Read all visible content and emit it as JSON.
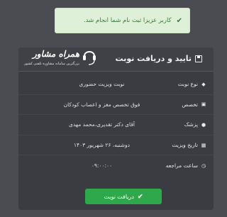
{
  "alert": {
    "message": "کاربر عزیزا ثبت نام شما انجام شد.",
    "icon": "check-icon"
  },
  "card": {
    "title": "تایید و دریافت نوبت",
    "title_icon": "save-icon"
  },
  "logo": {
    "name": "همراه مشاور",
    "tagline": "بزرگترین سامانه مشاوره تلفنی کشور",
    "icon": "headset-icon"
  },
  "rows": [
    {
      "icon": "tag-icon",
      "label": "نوع نوبت",
      "value": "نوبت ویزیت حضوری"
    },
    {
      "icon": "medkit-icon",
      "label": "تخصص",
      "value": "فوق تخصص مغز و اعصاب کودکان"
    },
    {
      "icon": "doctor-icon",
      "label": "پزشک",
      "value": "آقای دکتر تقدیری،محمد مهدی"
    },
    {
      "icon": "calendar-icon",
      "label": "تاریخ ویزیت",
      "value": "دوشنبه، ۲۶ شهریور ۱۴۰۳"
    },
    {
      "icon": "clock-icon",
      "label": "ساعت مراجعه",
      "value": "۰۹:۰۰:۰۰"
    }
  ],
  "button": {
    "label": "دریافت نوبت",
    "icon": "check-icon"
  },
  "colors": {
    "background": "#4a4c52",
    "alert_bg": "#dff0d8",
    "alert_text": "#3c763d",
    "card_bg": "#3a3c41",
    "button_bg": "#2ea84a"
  }
}
